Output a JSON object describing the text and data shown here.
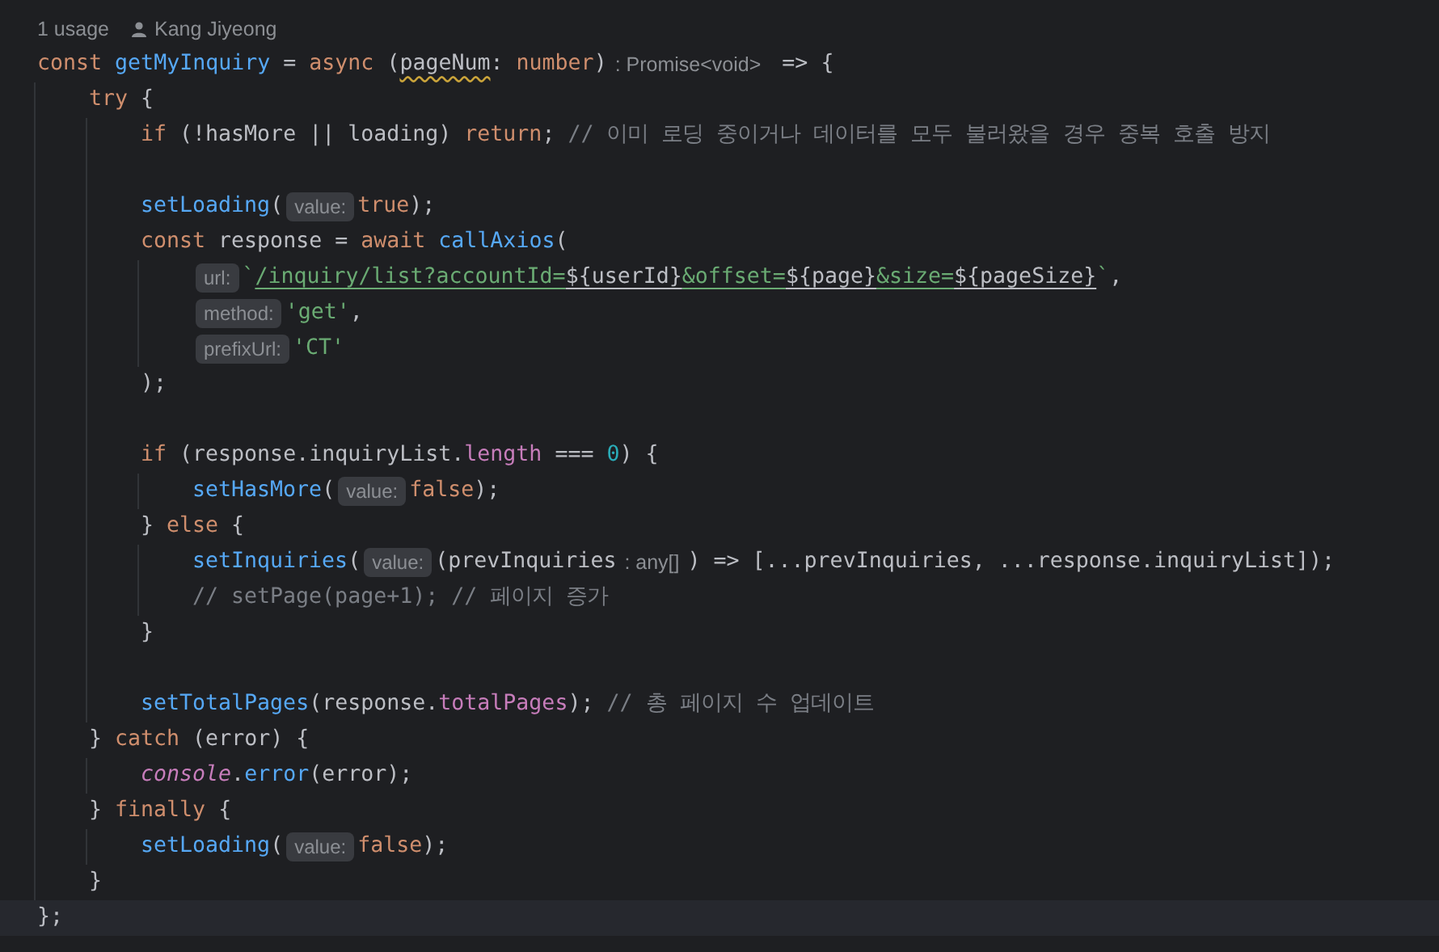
{
  "usage_line": {
    "usages": "1 usage",
    "author": "Kang Jiyeong"
  },
  "lines": [
    {
      "kind": "code",
      "current": false,
      "segments": [
        {
          "kind": "code",
          "tokens": [
            {
              "t": "const ",
              "kind": "kw"
            },
            {
              "t": "getMyInquiry",
              "kind": "fn"
            },
            {
              "t": " = ",
              "kind": "plain"
            },
            {
              "t": "async ",
              "kind": "kw"
            },
            {
              "t": "(",
              "kind": "plain"
            },
            {
              "t": "pageNum",
              "kind": "warn"
            },
            {
              "t": ": ",
              "kind": "plain"
            },
            {
              "t": "number",
              "kind": "kw"
            },
            {
              "t": ")",
              "kind": "plain"
            }
          ]
        },
        {
          "kind": "type",
          "text": ": Promise<void>"
        },
        {
          "kind": "code",
          "tokens": [
            {
              "t": " => {",
              "kind": "plain"
            }
          ]
        }
      ],
      "children": [
        {
          "kind": "code",
          "current": false,
          "segments": [
            {
              "kind": "code",
              "tokens": [
                {
                  "t": "try",
                  "kind": "kw"
                },
                {
                  "t": " {",
                  "kind": "plain"
                }
              ]
            }
          ],
          "children": [
            {
              "kind": "code",
              "current": false,
              "segments": [
                {
                  "kind": "code",
                  "tokens": [
                    {
                      "t": "if",
                      "kind": "kw"
                    },
                    {
                      "t": " (!hasMore || loading) ",
                      "kind": "plain"
                    },
                    {
                      "t": "return",
                      "kind": "kw"
                    },
                    {
                      "t": "; ",
                      "kind": "plain"
                    },
                    {
                      "t": "// 이미 로딩 중이거나 데이터를 모두 불러왔을 경우 중복 호출 방지",
                      "kind": "cmt"
                    }
                  ]
                }
              ]
            },
            {
              "kind": "blank"
            },
            {
              "kind": "code",
              "current": false,
              "segments": [
                {
                  "kind": "code",
                  "tokens": [
                    {
                      "t": "setLoading",
                      "kind": "fn"
                    },
                    {
                      "t": "(",
                      "kind": "plain"
                    }
                  ]
                },
                {
                  "kind": "hint",
                  "text": "value:"
                },
                {
                  "kind": "code",
                  "tokens": [
                    {
                      "t": "true",
                      "kind": "kw"
                    },
                    {
                      "t": ");",
                      "kind": "plain"
                    }
                  ]
                }
              ]
            },
            {
              "kind": "code",
              "current": false,
              "segments": [
                {
                  "kind": "code",
                  "tokens": [
                    {
                      "t": "const",
                      "kind": "kw"
                    },
                    {
                      "t": " response = ",
                      "kind": "plain"
                    },
                    {
                      "t": "await ",
                      "kind": "kw"
                    },
                    {
                      "t": "callAxios",
                      "kind": "fn"
                    },
                    {
                      "t": "(",
                      "kind": "plain"
                    }
                  ]
                }
              ],
              "children": [
                {
                  "kind": "code",
                  "current": false,
                  "segments": [
                    {
                      "kind": "hint",
                      "text": "url:"
                    },
                    {
                      "kind": "code",
                      "tokens": [
                        {
                          "t": "`",
                          "kind": "str"
                        },
                        {
                          "t": "/inquiry/list?accountId=",
                          "kind": "url"
                        },
                        {
                          "t": "${userId}",
                          "kind": "urlplain"
                        },
                        {
                          "t": "&offset=",
                          "kind": "url"
                        },
                        {
                          "t": "${page}",
                          "kind": "urlplain"
                        },
                        {
                          "t": "&size=",
                          "kind": "url"
                        },
                        {
                          "t": "${pageSize}",
                          "kind": "urlplain"
                        },
                        {
                          "t": "`",
                          "kind": "str"
                        },
                        {
                          "t": ",",
                          "kind": "plain"
                        }
                      ]
                    }
                  ]
                },
                {
                  "kind": "code",
                  "current": false,
                  "segments": [
                    {
                      "kind": "hint",
                      "text": "method:"
                    },
                    {
                      "kind": "code",
                      "tokens": [
                        {
                          "t": "'get'",
                          "kind": "str"
                        },
                        {
                          "t": ",",
                          "kind": "plain"
                        }
                      ]
                    }
                  ]
                },
                {
                  "kind": "code",
                  "current": false,
                  "segments": [
                    {
                      "kind": "hint",
                      "text": "prefixUrl:"
                    },
                    {
                      "kind": "code",
                      "tokens": [
                        {
                          "t": "'CT'",
                          "kind": "str"
                        }
                      ]
                    }
                  ]
                }
              ]
            },
            {
              "kind": "code",
              "current": false,
              "segments": [
                {
                  "kind": "code",
                  "tokens": [
                    {
                      "t": ");",
                      "kind": "plain"
                    }
                  ]
                }
              ]
            },
            {
              "kind": "blank"
            },
            {
              "kind": "code",
              "current": false,
              "segments": [
                {
                  "kind": "code",
                  "tokens": [
                    {
                      "t": "if",
                      "kind": "kw"
                    },
                    {
                      "t": " (response.inquiryList.",
                      "kind": "plain"
                    },
                    {
                      "t": "length",
                      "kind": "prop"
                    },
                    {
                      "t": " === ",
                      "kind": "plain"
                    },
                    {
                      "t": "0",
                      "kind": "num"
                    },
                    {
                      "t": ") {",
                      "kind": "plain"
                    }
                  ]
                }
              ],
              "children": [
                {
                  "kind": "code",
                  "current": false,
                  "segments": [
                    {
                      "kind": "code",
                      "tokens": [
                        {
                          "t": "setHasMore",
                          "kind": "fn"
                        },
                        {
                          "t": "(",
                          "kind": "plain"
                        }
                      ]
                    },
                    {
                      "kind": "hint",
                      "text": "value:"
                    },
                    {
                      "kind": "code",
                      "tokens": [
                        {
                          "t": "false",
                          "kind": "kw"
                        },
                        {
                          "t": ");",
                          "kind": "plain"
                        }
                      ]
                    }
                  ]
                }
              ]
            },
            {
              "kind": "code",
              "current": false,
              "segments": [
                {
                  "kind": "code",
                  "tokens": [
                    {
                      "t": "} ",
                      "kind": "plain"
                    },
                    {
                      "t": "else",
                      "kind": "kw"
                    },
                    {
                      "t": " {",
                      "kind": "plain"
                    }
                  ]
                }
              ],
              "children": [
                {
                  "kind": "code",
                  "current": false,
                  "segments": [
                    {
                      "kind": "code",
                      "tokens": [
                        {
                          "t": "setInquiries",
                          "kind": "fn"
                        },
                        {
                          "t": "(",
                          "kind": "plain"
                        }
                      ]
                    },
                    {
                      "kind": "hint",
                      "text": "value:"
                    },
                    {
                      "kind": "code",
                      "tokens": [
                        {
                          "t": "(prevInquiries",
                          "kind": "plain"
                        }
                      ]
                    },
                    {
                      "kind": "type",
                      "text": ": any[]"
                    },
                    {
                      "kind": "code",
                      "tokens": [
                        {
                          "t": ") => [...prevInquiries, ...response.inquiryList]);",
                          "kind": "plain"
                        }
                      ]
                    }
                  ]
                },
                {
                  "kind": "code",
                  "current": false,
                  "segments": [
                    {
                      "kind": "code",
                      "tokens": [
                        {
                          "t": "// setPage(page+1); // 페이지 증가",
                          "kind": "cmt"
                        }
                      ]
                    }
                  ]
                }
              ]
            },
            {
              "kind": "code",
              "current": false,
              "segments": [
                {
                  "kind": "code",
                  "tokens": [
                    {
                      "t": "}",
                      "kind": "plain"
                    }
                  ]
                }
              ]
            },
            {
              "kind": "blank"
            },
            {
              "kind": "code",
              "current": false,
              "segments": [
                {
                  "kind": "code",
                  "tokens": [
                    {
                      "t": "setTotalPages",
                      "kind": "fn"
                    },
                    {
                      "t": "(response.",
                      "kind": "plain"
                    },
                    {
                      "t": "totalPages",
                      "kind": "prop"
                    },
                    {
                      "t": "); ",
                      "kind": "plain"
                    },
                    {
                      "t": "// 총 페이지 수 업데이트",
                      "kind": "cmt"
                    }
                  ]
                }
              ]
            }
          ]
        },
        {
          "kind": "code",
          "current": false,
          "segments": [
            {
              "kind": "code",
              "tokens": [
                {
                  "t": "} ",
                  "kind": "plain"
                },
                {
                  "t": "catch",
                  "kind": "kw"
                },
                {
                  "t": " (error) {",
                  "kind": "plain"
                }
              ]
            }
          ],
          "children": [
            {
              "kind": "code",
              "current": false,
              "segments": [
                {
                  "kind": "code",
                  "tokens": [
                    {
                      "t": "console",
                      "kind": "obj"
                    },
                    {
                      "t": ".",
                      "kind": "plain"
                    },
                    {
                      "t": "error",
                      "kind": "fn"
                    },
                    {
                      "t": "(error);",
                      "kind": "plain"
                    }
                  ]
                }
              ]
            }
          ]
        },
        {
          "kind": "code",
          "current": false,
          "segments": [
            {
              "kind": "code",
              "tokens": [
                {
                  "t": "} ",
                  "kind": "plain"
                },
                {
                  "t": "finally",
                  "kind": "kw"
                },
                {
                  "t": " {",
                  "kind": "plain"
                }
              ]
            }
          ],
          "children": [
            {
              "kind": "code",
              "current": false,
              "segments": [
                {
                  "kind": "code",
                  "tokens": [
                    {
                      "t": "setLoading",
                      "kind": "fn"
                    },
                    {
                      "t": "(",
                      "kind": "plain"
                    }
                  ]
                },
                {
                  "kind": "hint",
                  "text": "value:"
                },
                {
                  "kind": "code",
                  "tokens": [
                    {
                      "t": "false",
                      "kind": "kw"
                    },
                    {
                      "t": ");",
                      "kind": "plain"
                    }
                  ]
                }
              ]
            }
          ]
        },
        {
          "kind": "code",
          "current": false,
          "segments": [
            {
              "kind": "code",
              "tokens": [
                {
                  "t": "}",
                  "kind": "plain"
                }
              ]
            }
          ]
        }
      ]
    },
    {
      "kind": "code",
      "current": true,
      "segments": [
        {
          "kind": "code",
          "tokens": [
            {
              "t": "};",
              "kind": "plain"
            }
          ]
        }
      ]
    }
  ]
}
